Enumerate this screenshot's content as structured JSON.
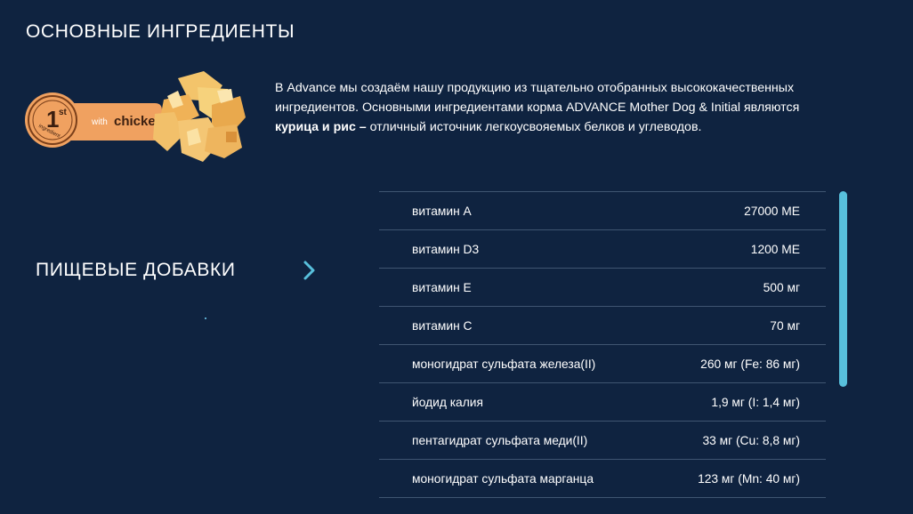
{
  "main_title": "ОСНОВНЫЕ ИНГРЕДИЕНТЫ",
  "badge": {
    "rank": "1",
    "rank_suffix": "st",
    "ring_text": "ingredient",
    "label_prefix": "with",
    "label_main": "chicken",
    "color_badge": "#f0a160",
    "color_ring": "#f5b27a"
  },
  "intro": {
    "part1": "В Advance мы создаём нашу продукцию из тщательно отобранных высококачественных ингредиентов. Основными ингредиентами корма ADVANCE Mother Dog & Initial являются ",
    "bold": "курица и рис –",
    "part2": " отличный источник легкоусвояемых белков и углеводов."
  },
  "additives": {
    "title": "ПИЩЕВЫЕ ДОБАВКИ",
    "chevron_icon": "chevron-right-icon",
    "accent_color": "#58c0dc"
  },
  "nutrients": [
    {
      "name": "витамин A",
      "value": "27000 МЕ"
    },
    {
      "name": "витамин D3",
      "value": "1200 МЕ"
    },
    {
      "name": "витамин E",
      "value": "500 мг"
    },
    {
      "name": "витамин C",
      "value": "70 мг"
    },
    {
      "name": "моногидрат сульфата железа(II)",
      "value": "260 мг (Fe: 86 мг)"
    },
    {
      "name": "йодид калия",
      "value": "1,9 мг (I: 1,4 мг)"
    },
    {
      "name": "пентагидрат сульфата меди(II)",
      "value": "33 мг (Cu: 8,8 мг)"
    },
    {
      "name": "моногидрат сульфата марганца",
      "value": "123 мг (Mn: 40 мг)"
    }
  ]
}
